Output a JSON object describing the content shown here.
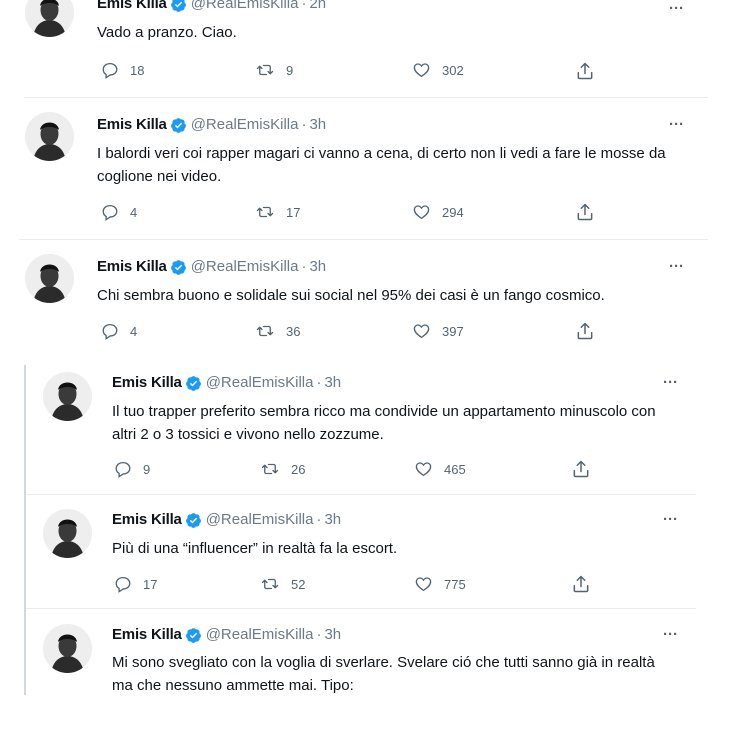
{
  "colors": {
    "accent": "#1d9bf0",
    "muted": "#536471",
    "divider": "#e6ecf0"
  },
  "tweets": [
    {
      "name": "Emis Killa",
      "handle": "@RealEmisKilla",
      "separator": "·",
      "time": "2h",
      "text": "Vado a pranzo. Ciao.",
      "replies": "18",
      "retweets": "9",
      "likes": "302"
    },
    {
      "name": "Emis Killa",
      "handle": "@RealEmisKilla",
      "separator": "·",
      "time": "3h",
      "text": "I balordi veri coi rapper magari ci vanno a cena, di certo non li vedi a fare le mosse da coglione nei video.",
      "replies": "4",
      "retweets": "17",
      "likes": "294"
    },
    {
      "name": "Emis Killa",
      "handle": "@RealEmisKilla",
      "separator": "·",
      "time": "3h",
      "text": "Chi sembra buono e solidale sui social nel 95% dei casi è un fango cosmico.",
      "replies": "4",
      "retweets": "36",
      "likes": "397"
    },
    {
      "name": "Emis Killa",
      "handle": "@RealEmisKilla",
      "separator": "·",
      "time": "3h",
      "text": "Il tuo trapper preferito sembra ricco ma condivide un appartamento minuscolo con altri 2 o 3 tossici e vivono nello zozzume.",
      "replies": "9",
      "retweets": "26",
      "likes": "465"
    },
    {
      "name": "Emis Killa",
      "handle": "@RealEmisKilla",
      "separator": "·",
      "time": "3h",
      "text": "Più di una “influencer” in realtà fa la escort.",
      "replies": "17",
      "retweets": "52",
      "likes": "775"
    },
    {
      "name": "Emis Killa",
      "handle": "@RealEmisKilla",
      "separator": "·",
      "time": "3h",
      "text": "Mi sono svegliato con la voglia di sverlare. Svelare ció che tutti sanno già in realtà ma che nessuno ammette mai. Tipo:"
    }
  ],
  "icons": {
    "reply": "reply-icon",
    "retweet": "retweet-icon",
    "like": "heart-icon",
    "share": "share-icon",
    "more": "more-icon",
    "verified": "verified-badge-icon"
  },
  "more_label": "···"
}
